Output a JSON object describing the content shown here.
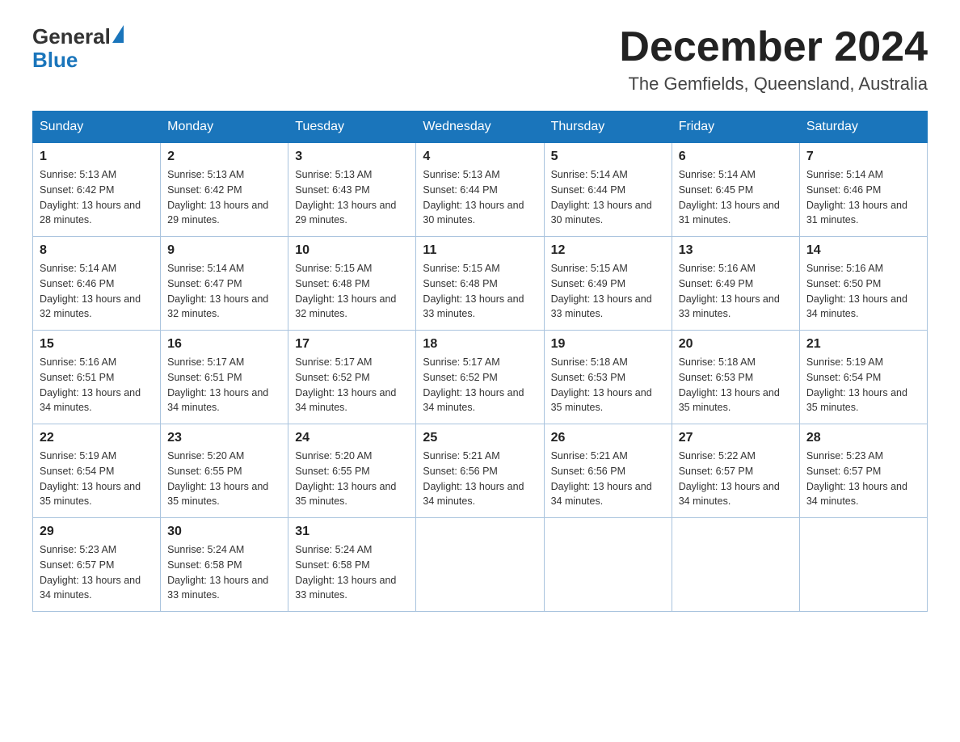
{
  "logo": {
    "text_general": "General",
    "text_blue": "Blue"
  },
  "title": "December 2024",
  "subtitle": "The Gemfields, Queensland, Australia",
  "days_of_week": [
    "Sunday",
    "Monday",
    "Tuesday",
    "Wednesday",
    "Thursday",
    "Friday",
    "Saturday"
  ],
  "weeks": [
    [
      {
        "day": "1",
        "sunrise": "5:13 AM",
        "sunset": "6:42 PM",
        "daylight": "13 hours and 28 minutes."
      },
      {
        "day": "2",
        "sunrise": "5:13 AM",
        "sunset": "6:42 PM",
        "daylight": "13 hours and 29 minutes."
      },
      {
        "day": "3",
        "sunrise": "5:13 AM",
        "sunset": "6:43 PM",
        "daylight": "13 hours and 29 minutes."
      },
      {
        "day": "4",
        "sunrise": "5:13 AM",
        "sunset": "6:44 PM",
        "daylight": "13 hours and 30 minutes."
      },
      {
        "day": "5",
        "sunrise": "5:14 AM",
        "sunset": "6:44 PM",
        "daylight": "13 hours and 30 minutes."
      },
      {
        "day": "6",
        "sunrise": "5:14 AM",
        "sunset": "6:45 PM",
        "daylight": "13 hours and 31 minutes."
      },
      {
        "day": "7",
        "sunrise": "5:14 AM",
        "sunset": "6:46 PM",
        "daylight": "13 hours and 31 minutes."
      }
    ],
    [
      {
        "day": "8",
        "sunrise": "5:14 AM",
        "sunset": "6:46 PM",
        "daylight": "13 hours and 32 minutes."
      },
      {
        "day": "9",
        "sunrise": "5:14 AM",
        "sunset": "6:47 PM",
        "daylight": "13 hours and 32 minutes."
      },
      {
        "day": "10",
        "sunrise": "5:15 AM",
        "sunset": "6:48 PM",
        "daylight": "13 hours and 32 minutes."
      },
      {
        "day": "11",
        "sunrise": "5:15 AM",
        "sunset": "6:48 PM",
        "daylight": "13 hours and 33 minutes."
      },
      {
        "day": "12",
        "sunrise": "5:15 AM",
        "sunset": "6:49 PM",
        "daylight": "13 hours and 33 minutes."
      },
      {
        "day": "13",
        "sunrise": "5:16 AM",
        "sunset": "6:49 PM",
        "daylight": "13 hours and 33 minutes."
      },
      {
        "day": "14",
        "sunrise": "5:16 AM",
        "sunset": "6:50 PM",
        "daylight": "13 hours and 34 minutes."
      }
    ],
    [
      {
        "day": "15",
        "sunrise": "5:16 AM",
        "sunset": "6:51 PM",
        "daylight": "13 hours and 34 minutes."
      },
      {
        "day": "16",
        "sunrise": "5:17 AM",
        "sunset": "6:51 PM",
        "daylight": "13 hours and 34 minutes."
      },
      {
        "day": "17",
        "sunrise": "5:17 AM",
        "sunset": "6:52 PM",
        "daylight": "13 hours and 34 minutes."
      },
      {
        "day": "18",
        "sunrise": "5:17 AM",
        "sunset": "6:52 PM",
        "daylight": "13 hours and 34 minutes."
      },
      {
        "day": "19",
        "sunrise": "5:18 AM",
        "sunset": "6:53 PM",
        "daylight": "13 hours and 35 minutes."
      },
      {
        "day": "20",
        "sunrise": "5:18 AM",
        "sunset": "6:53 PM",
        "daylight": "13 hours and 35 minutes."
      },
      {
        "day": "21",
        "sunrise": "5:19 AM",
        "sunset": "6:54 PM",
        "daylight": "13 hours and 35 minutes."
      }
    ],
    [
      {
        "day": "22",
        "sunrise": "5:19 AM",
        "sunset": "6:54 PM",
        "daylight": "13 hours and 35 minutes."
      },
      {
        "day": "23",
        "sunrise": "5:20 AM",
        "sunset": "6:55 PM",
        "daylight": "13 hours and 35 minutes."
      },
      {
        "day": "24",
        "sunrise": "5:20 AM",
        "sunset": "6:55 PM",
        "daylight": "13 hours and 35 minutes."
      },
      {
        "day": "25",
        "sunrise": "5:21 AM",
        "sunset": "6:56 PM",
        "daylight": "13 hours and 34 minutes."
      },
      {
        "day": "26",
        "sunrise": "5:21 AM",
        "sunset": "6:56 PM",
        "daylight": "13 hours and 34 minutes."
      },
      {
        "day": "27",
        "sunrise": "5:22 AM",
        "sunset": "6:57 PM",
        "daylight": "13 hours and 34 minutes."
      },
      {
        "day": "28",
        "sunrise": "5:23 AM",
        "sunset": "6:57 PM",
        "daylight": "13 hours and 34 minutes."
      }
    ],
    [
      {
        "day": "29",
        "sunrise": "5:23 AM",
        "sunset": "6:57 PM",
        "daylight": "13 hours and 34 minutes."
      },
      {
        "day": "30",
        "sunrise": "5:24 AM",
        "sunset": "6:58 PM",
        "daylight": "13 hours and 33 minutes."
      },
      {
        "day": "31",
        "sunrise": "5:24 AM",
        "sunset": "6:58 PM",
        "daylight": "13 hours and 33 minutes."
      },
      null,
      null,
      null,
      null
    ]
  ],
  "labels": {
    "sunrise_prefix": "Sunrise: ",
    "sunset_prefix": "Sunset: ",
    "daylight_prefix": "Daylight: "
  }
}
